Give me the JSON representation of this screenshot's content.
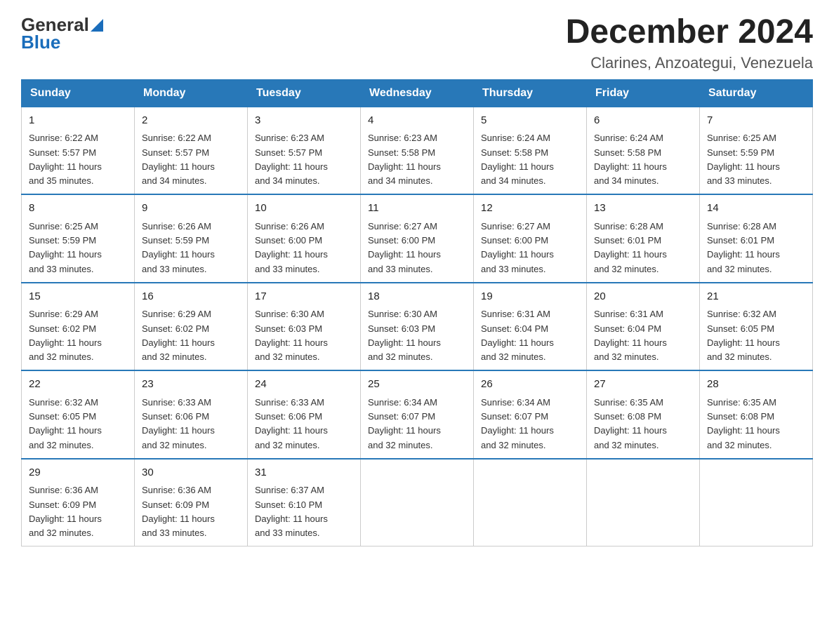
{
  "header": {
    "logo_general": "General",
    "logo_blue": "Blue",
    "month_title": "December 2024",
    "location": "Clarines, Anzoategui, Venezuela"
  },
  "columns": [
    "Sunday",
    "Monday",
    "Tuesday",
    "Wednesday",
    "Thursday",
    "Friday",
    "Saturday"
  ],
  "weeks": [
    [
      {
        "day": "1",
        "sunrise": "6:22 AM",
        "sunset": "5:57 PM",
        "daylight": "11 hours and 35 minutes."
      },
      {
        "day": "2",
        "sunrise": "6:22 AM",
        "sunset": "5:57 PM",
        "daylight": "11 hours and 34 minutes."
      },
      {
        "day": "3",
        "sunrise": "6:23 AM",
        "sunset": "5:57 PM",
        "daylight": "11 hours and 34 minutes."
      },
      {
        "day": "4",
        "sunrise": "6:23 AM",
        "sunset": "5:58 PM",
        "daylight": "11 hours and 34 minutes."
      },
      {
        "day": "5",
        "sunrise": "6:24 AM",
        "sunset": "5:58 PM",
        "daylight": "11 hours and 34 minutes."
      },
      {
        "day": "6",
        "sunrise": "6:24 AM",
        "sunset": "5:58 PM",
        "daylight": "11 hours and 34 minutes."
      },
      {
        "day": "7",
        "sunrise": "6:25 AM",
        "sunset": "5:59 PM",
        "daylight": "11 hours and 33 minutes."
      }
    ],
    [
      {
        "day": "8",
        "sunrise": "6:25 AM",
        "sunset": "5:59 PM",
        "daylight": "11 hours and 33 minutes."
      },
      {
        "day": "9",
        "sunrise": "6:26 AM",
        "sunset": "5:59 PM",
        "daylight": "11 hours and 33 minutes."
      },
      {
        "day": "10",
        "sunrise": "6:26 AM",
        "sunset": "6:00 PM",
        "daylight": "11 hours and 33 minutes."
      },
      {
        "day": "11",
        "sunrise": "6:27 AM",
        "sunset": "6:00 PM",
        "daylight": "11 hours and 33 minutes."
      },
      {
        "day": "12",
        "sunrise": "6:27 AM",
        "sunset": "6:00 PM",
        "daylight": "11 hours and 33 minutes."
      },
      {
        "day": "13",
        "sunrise": "6:28 AM",
        "sunset": "6:01 PM",
        "daylight": "11 hours and 32 minutes."
      },
      {
        "day": "14",
        "sunrise": "6:28 AM",
        "sunset": "6:01 PM",
        "daylight": "11 hours and 32 minutes."
      }
    ],
    [
      {
        "day": "15",
        "sunrise": "6:29 AM",
        "sunset": "6:02 PM",
        "daylight": "11 hours and 32 minutes."
      },
      {
        "day": "16",
        "sunrise": "6:29 AM",
        "sunset": "6:02 PM",
        "daylight": "11 hours and 32 minutes."
      },
      {
        "day": "17",
        "sunrise": "6:30 AM",
        "sunset": "6:03 PM",
        "daylight": "11 hours and 32 minutes."
      },
      {
        "day": "18",
        "sunrise": "6:30 AM",
        "sunset": "6:03 PM",
        "daylight": "11 hours and 32 minutes."
      },
      {
        "day": "19",
        "sunrise": "6:31 AM",
        "sunset": "6:04 PM",
        "daylight": "11 hours and 32 minutes."
      },
      {
        "day": "20",
        "sunrise": "6:31 AM",
        "sunset": "6:04 PM",
        "daylight": "11 hours and 32 minutes."
      },
      {
        "day": "21",
        "sunrise": "6:32 AM",
        "sunset": "6:05 PM",
        "daylight": "11 hours and 32 minutes."
      }
    ],
    [
      {
        "day": "22",
        "sunrise": "6:32 AM",
        "sunset": "6:05 PM",
        "daylight": "11 hours and 32 minutes."
      },
      {
        "day": "23",
        "sunrise": "6:33 AM",
        "sunset": "6:06 PM",
        "daylight": "11 hours and 32 minutes."
      },
      {
        "day": "24",
        "sunrise": "6:33 AM",
        "sunset": "6:06 PM",
        "daylight": "11 hours and 32 minutes."
      },
      {
        "day": "25",
        "sunrise": "6:34 AM",
        "sunset": "6:07 PM",
        "daylight": "11 hours and 32 minutes."
      },
      {
        "day": "26",
        "sunrise": "6:34 AM",
        "sunset": "6:07 PM",
        "daylight": "11 hours and 32 minutes."
      },
      {
        "day": "27",
        "sunrise": "6:35 AM",
        "sunset": "6:08 PM",
        "daylight": "11 hours and 32 minutes."
      },
      {
        "day": "28",
        "sunrise": "6:35 AM",
        "sunset": "6:08 PM",
        "daylight": "11 hours and 32 minutes."
      }
    ],
    [
      {
        "day": "29",
        "sunrise": "6:36 AM",
        "sunset": "6:09 PM",
        "daylight": "11 hours and 32 minutes."
      },
      {
        "day": "30",
        "sunrise": "6:36 AM",
        "sunset": "6:09 PM",
        "daylight": "11 hours and 33 minutes."
      },
      {
        "day": "31",
        "sunrise": "6:37 AM",
        "sunset": "6:10 PM",
        "daylight": "11 hours and 33 minutes."
      },
      null,
      null,
      null,
      null
    ]
  ],
  "labels": {
    "sunrise": "Sunrise:",
    "sunset": "Sunset:",
    "daylight": "Daylight:"
  }
}
